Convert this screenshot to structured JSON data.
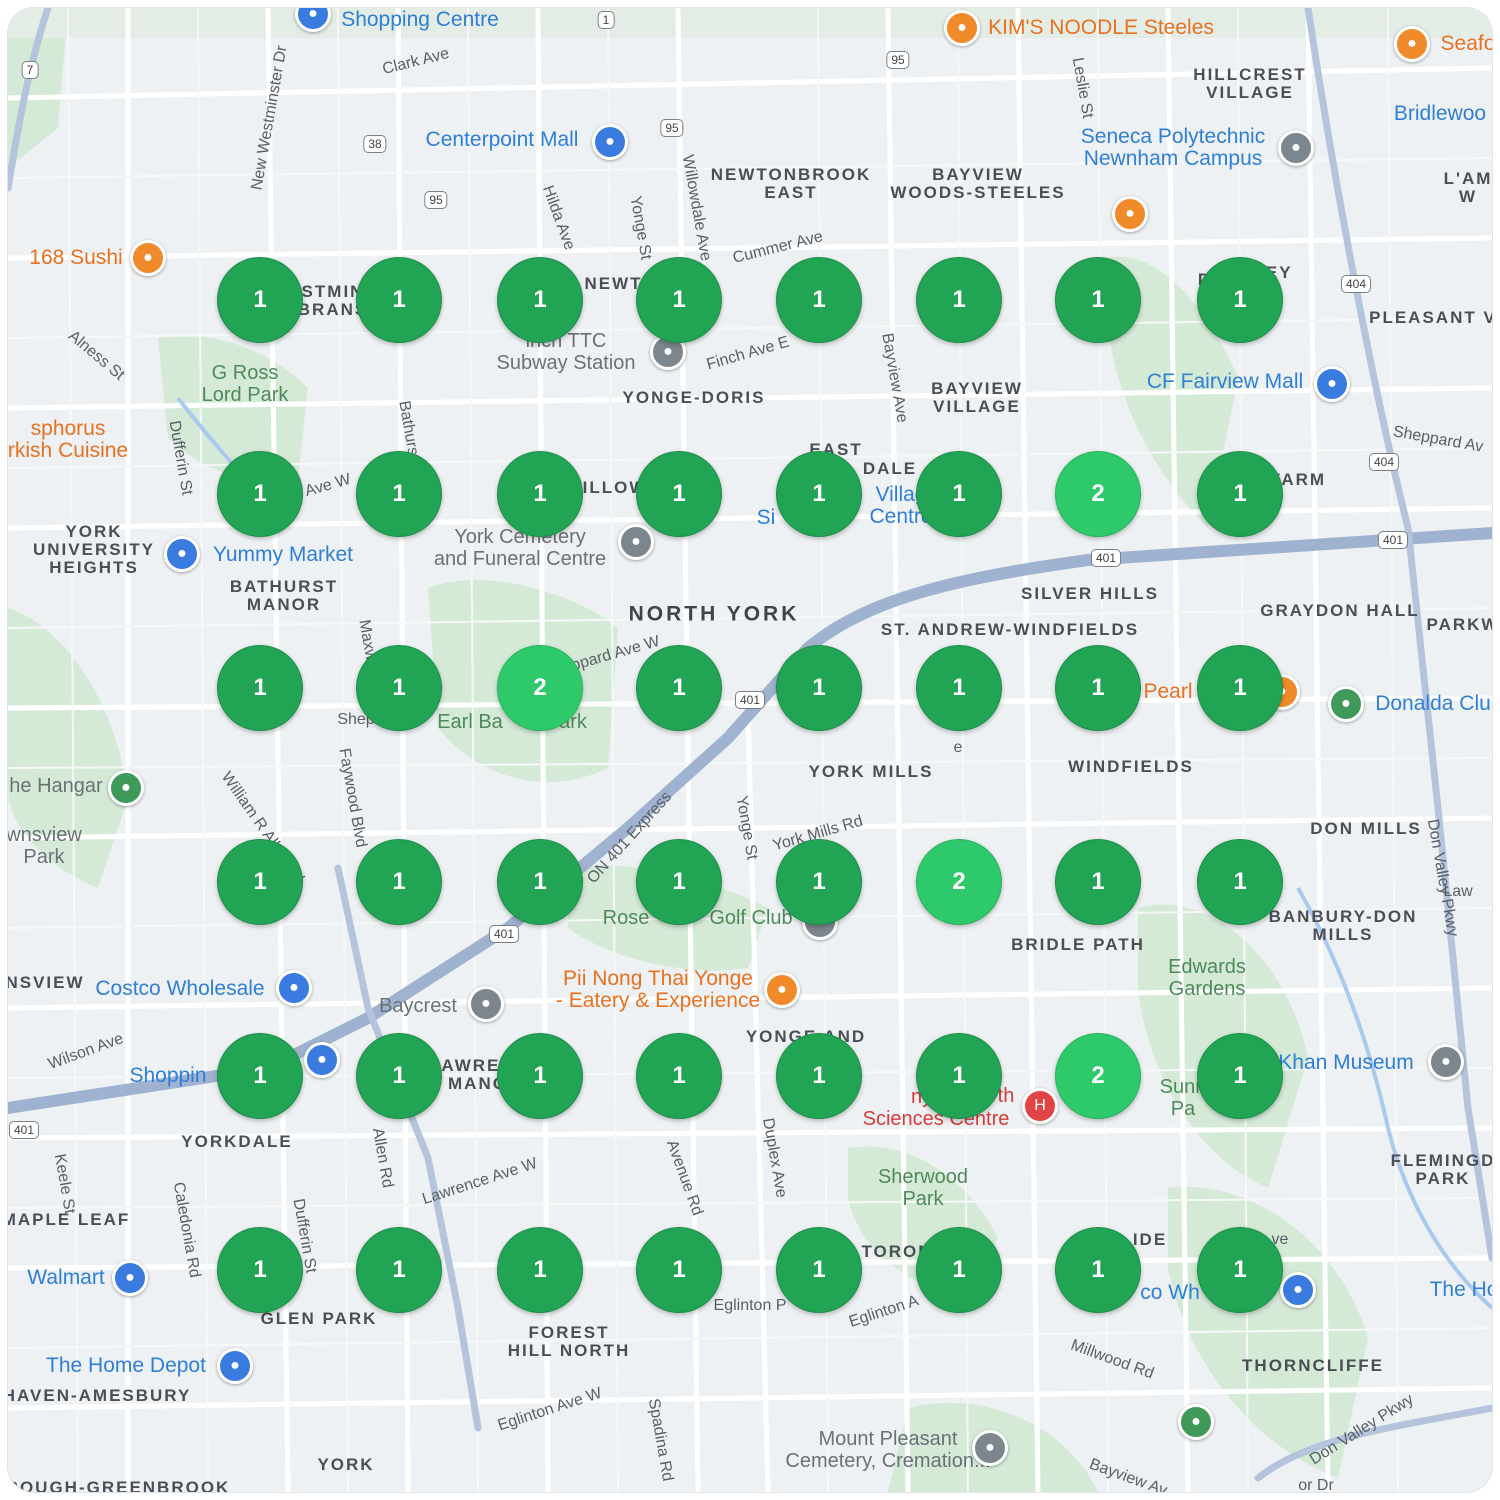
{
  "map": {
    "area_labels": [
      "NEWTONBROOK\nEAST",
      "BAYVIEW\nWOODS-STEELES",
      "HILLCREST\nVILLAGE",
      "YONGE-DORIS",
      "BAYVIEW\nVILLAGE",
      "PLEASANT VIE",
      "YORK\nUNIVERSITY\nHEIGHTS",
      "BATHURST\nMANOR",
      "SILVER HILLS",
      "ST. ANDREW-WINDFIELDS",
      "GRAYDON HALL",
      "PARKW",
      "YORK MILLS",
      "WINDFIELDS",
      "DON MILLS",
      "BANBURY-DON\nMILLS",
      "BRIDLE PATH",
      "YORKDALE",
      "MAPLE LEAF",
      "FLEMINGD\nPARK",
      "GLEN PARK",
      "FOREST\nHILL NORTH",
      "THORNCLIFFE",
      "HAVEN-AMESBURY",
      "YORK",
      "ROUGH-GREENBROOK",
      "NSVIEW",
      "L'AM\nW",
      "EAST",
      "DALE",
      "FARM",
      "ILLOW",
      "NEWTO",
      "STMIN\nBRANS",
      "D",
      "LEY\nE",
      "AWREN\nMANO",
      "YONGE AND\nLA",
      "TORON",
      "IDE"
    ],
    "big_label": "NORTH YORK",
    "poi_labels": [
      "Shopping Centre",
      "Centerpoint Mall",
      "CF Fairview Mall",
      "Yummy Market",
      "Costco Wholesale",
      "Walmart",
      "The Home Depot",
      "Shoppin",
      "Bridlewoo",
      "The Ho",
      "Khan Museum",
      "Donalda Clu",
      "Seneca Polytechnic\nNewnham Campus",
      "Villag\nCentre",
      "Si",
      "co Wh"
    ],
    "food_labels": [
      "KIM'S NOODLE Steeles",
      "Seafo",
      "168 Sushi",
      "sphorus\nrkish Cuisine",
      "Pearl",
      "Pii Nong Thai Yonge\n- Eatery & Experience"
    ],
    "park_labels": [
      "G Ross\nLord Park",
      "Earl Ba",
      "ark",
      "Rose",
      "Golf Club",
      "Edwards\nGardens",
      "Sherwood\nPark",
      "Sunn\nPa"
    ],
    "gray_labels": [
      "inch TTC\nSubway Station",
      "York Cemetery\nand Funeral Centre",
      "Baycrest",
      "he Hangar",
      "wnsview\nPark",
      "Mount Pleasant\nCemetery, Cremation..."
    ],
    "medical_labels": [
      "nybro\nSciences Centre",
      "th"
    ],
    "street_labels": [
      "Clark Ave",
      "New Westminster Dr",
      "Hilda Ave",
      "Yonge St",
      "Willowdale Ave",
      "Cummer Ave",
      "Leslie St",
      "Finch Ave E",
      "Bayview Ave",
      "Alness St",
      "Dufferin St",
      "Bathurst St",
      "Ave W",
      "Shep",
      "Sheppard Ave W",
      "Maxwell St",
      "William R Allen Rd",
      "Faywood Blvd",
      "Yonge St",
      "York Mills Rd",
      "ON 401 Express",
      "Wilson Ave",
      "Keele St",
      "Caledonia Rd",
      "Dufferin St",
      "Allen Rd",
      "Lawrence Ave W",
      "Avenue Rd",
      "Duplex Ave",
      "Eglinton Ave W",
      "Spadina Rd",
      "Eglinton A",
      "Millwood Rd",
      "Don Valley Pkwy",
      "Bayview Av",
      "Law",
      "Sheppard Av",
      "e",
      "Don Valley Pkwy",
      "Eglinton P",
      "or Dr",
      "ve",
      "Wi"
    ],
    "shields": [
      "7",
      "38",
      "95",
      "95",
      "95",
      "1",
      "404",
      "404",
      "401",
      "401",
      "401",
      "401",
      "401"
    ],
    "clusters": [
      [
        1,
        1,
        1,
        1,
        1,
        1,
        1,
        1
      ],
      [
        1,
        1,
        1,
        1,
        1,
        1,
        2,
        1
      ],
      [
        1,
        1,
        2,
        1,
        1,
        1,
        1,
        1
      ],
      [
        1,
        1,
        1,
        1,
        1,
        2,
        1,
        1
      ],
      [
        1,
        1,
        1,
        1,
        1,
        1,
        2,
        1
      ],
      [
        1,
        1,
        1,
        1,
        1,
        1,
        1,
        1
      ]
    ],
    "colors": {
      "cluster_single": "#22a455",
      "cluster_double": "#2ec96a",
      "highway": "#8fa6c9",
      "water": "#a9c9ee",
      "park": "#cfe7d3"
    }
  }
}
